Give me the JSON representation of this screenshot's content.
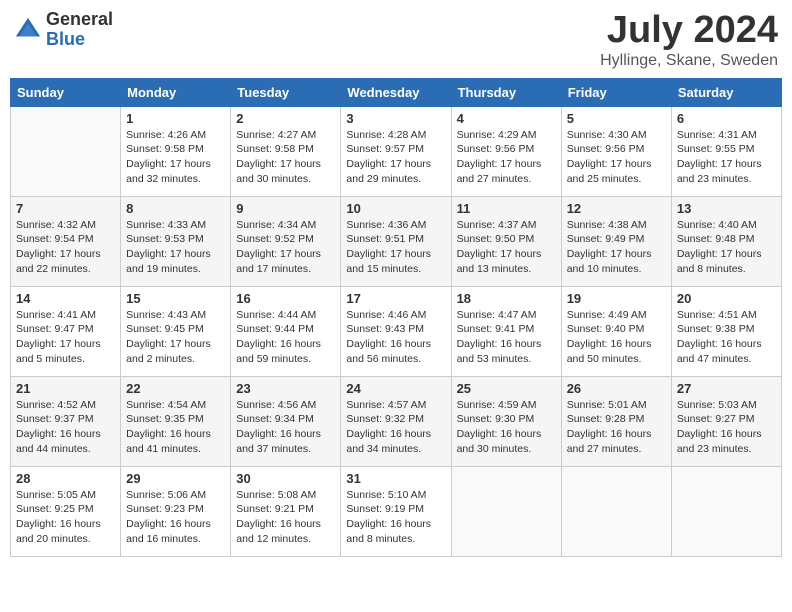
{
  "header": {
    "logo_general": "General",
    "logo_blue": "Blue",
    "month_year": "July 2024",
    "location": "Hyllinge, Skane, Sweden"
  },
  "days_of_week": [
    "Sunday",
    "Monday",
    "Tuesday",
    "Wednesday",
    "Thursday",
    "Friday",
    "Saturday"
  ],
  "weeks": [
    [
      {
        "day": "",
        "sunrise": "",
        "sunset": "",
        "daylight": ""
      },
      {
        "day": "1",
        "sunrise": "Sunrise: 4:26 AM",
        "sunset": "Sunset: 9:58 PM",
        "daylight": "Daylight: 17 hours and 32 minutes."
      },
      {
        "day": "2",
        "sunrise": "Sunrise: 4:27 AM",
        "sunset": "Sunset: 9:58 PM",
        "daylight": "Daylight: 17 hours and 30 minutes."
      },
      {
        "day": "3",
        "sunrise": "Sunrise: 4:28 AM",
        "sunset": "Sunset: 9:57 PM",
        "daylight": "Daylight: 17 hours and 29 minutes."
      },
      {
        "day": "4",
        "sunrise": "Sunrise: 4:29 AM",
        "sunset": "Sunset: 9:56 PM",
        "daylight": "Daylight: 17 hours and 27 minutes."
      },
      {
        "day": "5",
        "sunrise": "Sunrise: 4:30 AM",
        "sunset": "Sunset: 9:56 PM",
        "daylight": "Daylight: 17 hours and 25 minutes."
      },
      {
        "day": "6",
        "sunrise": "Sunrise: 4:31 AM",
        "sunset": "Sunset: 9:55 PM",
        "daylight": "Daylight: 17 hours and 23 minutes."
      }
    ],
    [
      {
        "day": "7",
        "sunrise": "Sunrise: 4:32 AM",
        "sunset": "Sunset: 9:54 PM",
        "daylight": "Daylight: 17 hours and 22 minutes."
      },
      {
        "day": "8",
        "sunrise": "Sunrise: 4:33 AM",
        "sunset": "Sunset: 9:53 PM",
        "daylight": "Daylight: 17 hours and 19 minutes."
      },
      {
        "day": "9",
        "sunrise": "Sunrise: 4:34 AM",
        "sunset": "Sunset: 9:52 PM",
        "daylight": "Daylight: 17 hours and 17 minutes."
      },
      {
        "day": "10",
        "sunrise": "Sunrise: 4:36 AM",
        "sunset": "Sunset: 9:51 PM",
        "daylight": "Daylight: 17 hours and 15 minutes."
      },
      {
        "day": "11",
        "sunrise": "Sunrise: 4:37 AM",
        "sunset": "Sunset: 9:50 PM",
        "daylight": "Daylight: 17 hours and 13 minutes."
      },
      {
        "day": "12",
        "sunrise": "Sunrise: 4:38 AM",
        "sunset": "Sunset: 9:49 PM",
        "daylight": "Daylight: 17 hours and 10 minutes."
      },
      {
        "day": "13",
        "sunrise": "Sunrise: 4:40 AM",
        "sunset": "Sunset: 9:48 PM",
        "daylight": "Daylight: 17 hours and 8 minutes."
      }
    ],
    [
      {
        "day": "14",
        "sunrise": "Sunrise: 4:41 AM",
        "sunset": "Sunset: 9:47 PM",
        "daylight": "Daylight: 17 hours and 5 minutes."
      },
      {
        "day": "15",
        "sunrise": "Sunrise: 4:43 AM",
        "sunset": "Sunset: 9:45 PM",
        "daylight": "Daylight: 17 hours and 2 minutes."
      },
      {
        "day": "16",
        "sunrise": "Sunrise: 4:44 AM",
        "sunset": "Sunset: 9:44 PM",
        "daylight": "Daylight: 16 hours and 59 minutes."
      },
      {
        "day": "17",
        "sunrise": "Sunrise: 4:46 AM",
        "sunset": "Sunset: 9:43 PM",
        "daylight": "Daylight: 16 hours and 56 minutes."
      },
      {
        "day": "18",
        "sunrise": "Sunrise: 4:47 AM",
        "sunset": "Sunset: 9:41 PM",
        "daylight": "Daylight: 16 hours and 53 minutes."
      },
      {
        "day": "19",
        "sunrise": "Sunrise: 4:49 AM",
        "sunset": "Sunset: 9:40 PM",
        "daylight": "Daylight: 16 hours and 50 minutes."
      },
      {
        "day": "20",
        "sunrise": "Sunrise: 4:51 AM",
        "sunset": "Sunset: 9:38 PM",
        "daylight": "Daylight: 16 hours and 47 minutes."
      }
    ],
    [
      {
        "day": "21",
        "sunrise": "Sunrise: 4:52 AM",
        "sunset": "Sunset: 9:37 PM",
        "daylight": "Daylight: 16 hours and 44 minutes."
      },
      {
        "day": "22",
        "sunrise": "Sunrise: 4:54 AM",
        "sunset": "Sunset: 9:35 PM",
        "daylight": "Daylight: 16 hours and 41 minutes."
      },
      {
        "day": "23",
        "sunrise": "Sunrise: 4:56 AM",
        "sunset": "Sunset: 9:34 PM",
        "daylight": "Daylight: 16 hours and 37 minutes."
      },
      {
        "day": "24",
        "sunrise": "Sunrise: 4:57 AM",
        "sunset": "Sunset: 9:32 PM",
        "daylight": "Daylight: 16 hours and 34 minutes."
      },
      {
        "day": "25",
        "sunrise": "Sunrise: 4:59 AM",
        "sunset": "Sunset: 9:30 PM",
        "daylight": "Daylight: 16 hours and 30 minutes."
      },
      {
        "day": "26",
        "sunrise": "Sunrise: 5:01 AM",
        "sunset": "Sunset: 9:28 PM",
        "daylight": "Daylight: 16 hours and 27 minutes."
      },
      {
        "day": "27",
        "sunrise": "Sunrise: 5:03 AM",
        "sunset": "Sunset: 9:27 PM",
        "daylight": "Daylight: 16 hours and 23 minutes."
      }
    ],
    [
      {
        "day": "28",
        "sunrise": "Sunrise: 5:05 AM",
        "sunset": "Sunset: 9:25 PM",
        "daylight": "Daylight: 16 hours and 20 minutes."
      },
      {
        "day": "29",
        "sunrise": "Sunrise: 5:06 AM",
        "sunset": "Sunset: 9:23 PM",
        "daylight": "Daylight: 16 hours and 16 minutes."
      },
      {
        "day": "30",
        "sunrise": "Sunrise: 5:08 AM",
        "sunset": "Sunset: 9:21 PM",
        "daylight": "Daylight: 16 hours and 12 minutes."
      },
      {
        "day": "31",
        "sunrise": "Sunrise: 5:10 AM",
        "sunset": "Sunset: 9:19 PM",
        "daylight": "Daylight: 16 hours and 8 minutes."
      },
      {
        "day": "",
        "sunrise": "",
        "sunset": "",
        "daylight": ""
      },
      {
        "day": "",
        "sunrise": "",
        "sunset": "",
        "daylight": ""
      },
      {
        "day": "",
        "sunrise": "",
        "sunset": "",
        "daylight": ""
      }
    ]
  ]
}
